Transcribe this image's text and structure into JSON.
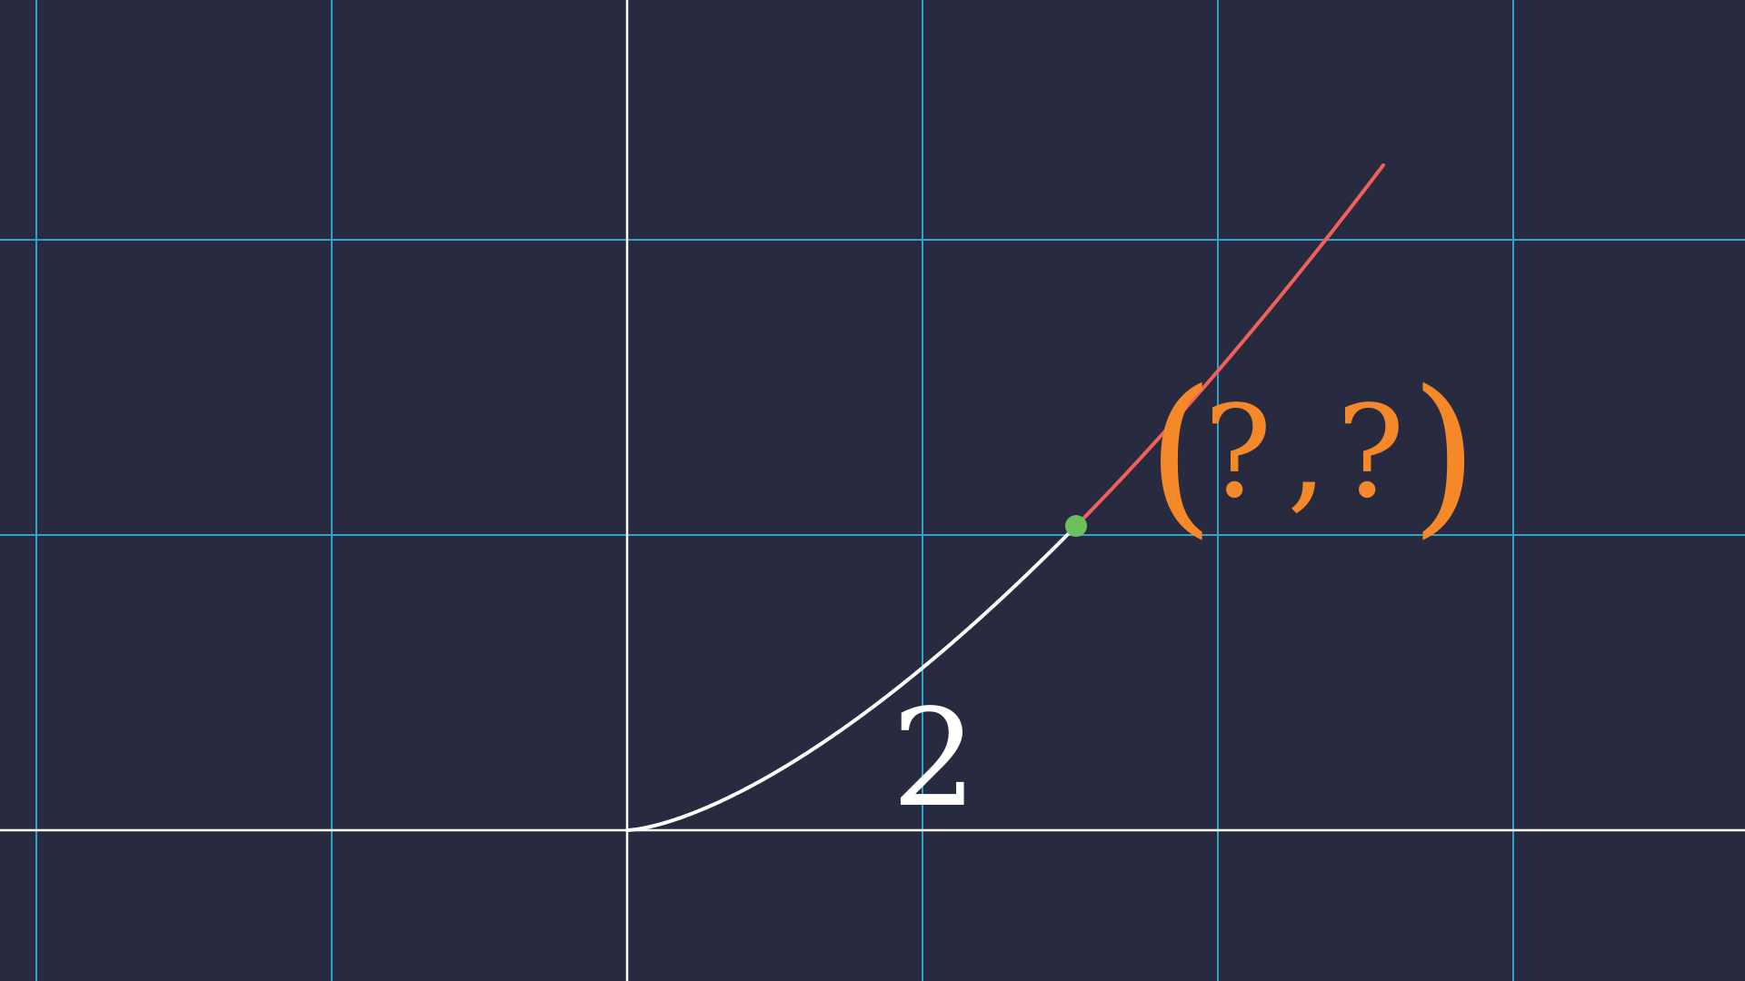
{
  "colors": {
    "background": "#282b40",
    "grid": "#2fa3cc",
    "axes": "#ffffff",
    "curve_traced": "#ffffff",
    "curve_remaining": "#f2605a",
    "point": "#6cbf5a",
    "coord_label": "#f5892a",
    "arc_label": "#ffffff"
  },
  "grid": {
    "x_min": -2,
    "x_max": 3,
    "y_min": -0.5,
    "y_max": 2.8,
    "step": 1
  },
  "curve": {
    "t_min": 0,
    "t_split": 1.52,
    "t_max": 2.56
  },
  "point": {
    "t": 1.52
  },
  "labels": {
    "arc_length": "2",
    "coord_open": "(",
    "coord_x": "?",
    "coord_sep": ",",
    "coord_y": "?",
    "coord_close": ")"
  }
}
